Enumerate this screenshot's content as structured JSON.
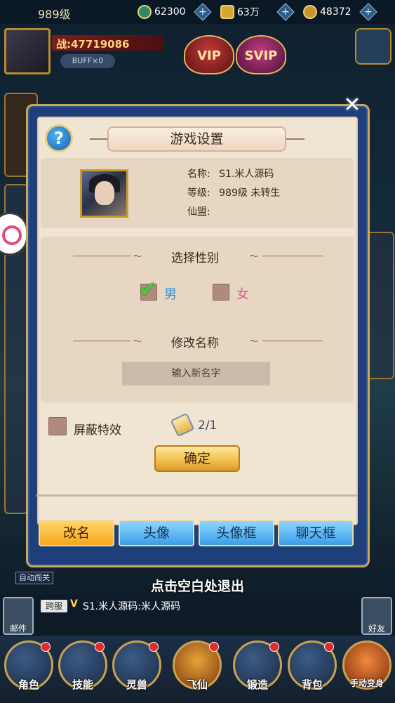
{
  "hud": {
    "level": "989级",
    "jade": "62300",
    "gold": "63万",
    "coins": "48372",
    "power": "战:47719086",
    "buff": "BUFF×0",
    "vip_label": "VIP",
    "svip_label": "SVIP"
  },
  "dialog": {
    "title": "游戏设置",
    "help_symbol": "?",
    "close_symbol": "✕",
    "player": {
      "name_label": "名称:",
      "name_value": "S1.米人源码",
      "level_label": "等级:",
      "level_value": "989级 未转生",
      "guild_label": "仙盟:",
      "guild_value": ""
    },
    "gender": {
      "section_title": "选择性别",
      "male": "男",
      "female": "女",
      "selected": "male"
    },
    "rename": {
      "section_title": "修改名称",
      "placeholder": "输入新名字"
    },
    "effects_label": "屏蔽特效",
    "rename_card_count": "2/1",
    "confirm_label": "确定",
    "tabs": [
      "改名",
      "头像",
      "头像框",
      "聊天框"
    ],
    "active_tab": 0
  },
  "exit_hint": "点击空白处退出",
  "auto_tag": "自动闯关",
  "chat": {
    "channel": "跨服",
    "v_mark": "V",
    "message": "S1.米人源码:米人源码"
  },
  "mail_label": "邮件",
  "friend_label": "好友",
  "bottom_nav": [
    "角色",
    "技能",
    "灵兽",
    "飞仙",
    "锻造",
    "背包",
    "手动变身"
  ],
  "colors": {
    "male_text": "#2f8fe0",
    "female_text": "#e05a9a",
    "check_green": "#3fd23f"
  }
}
